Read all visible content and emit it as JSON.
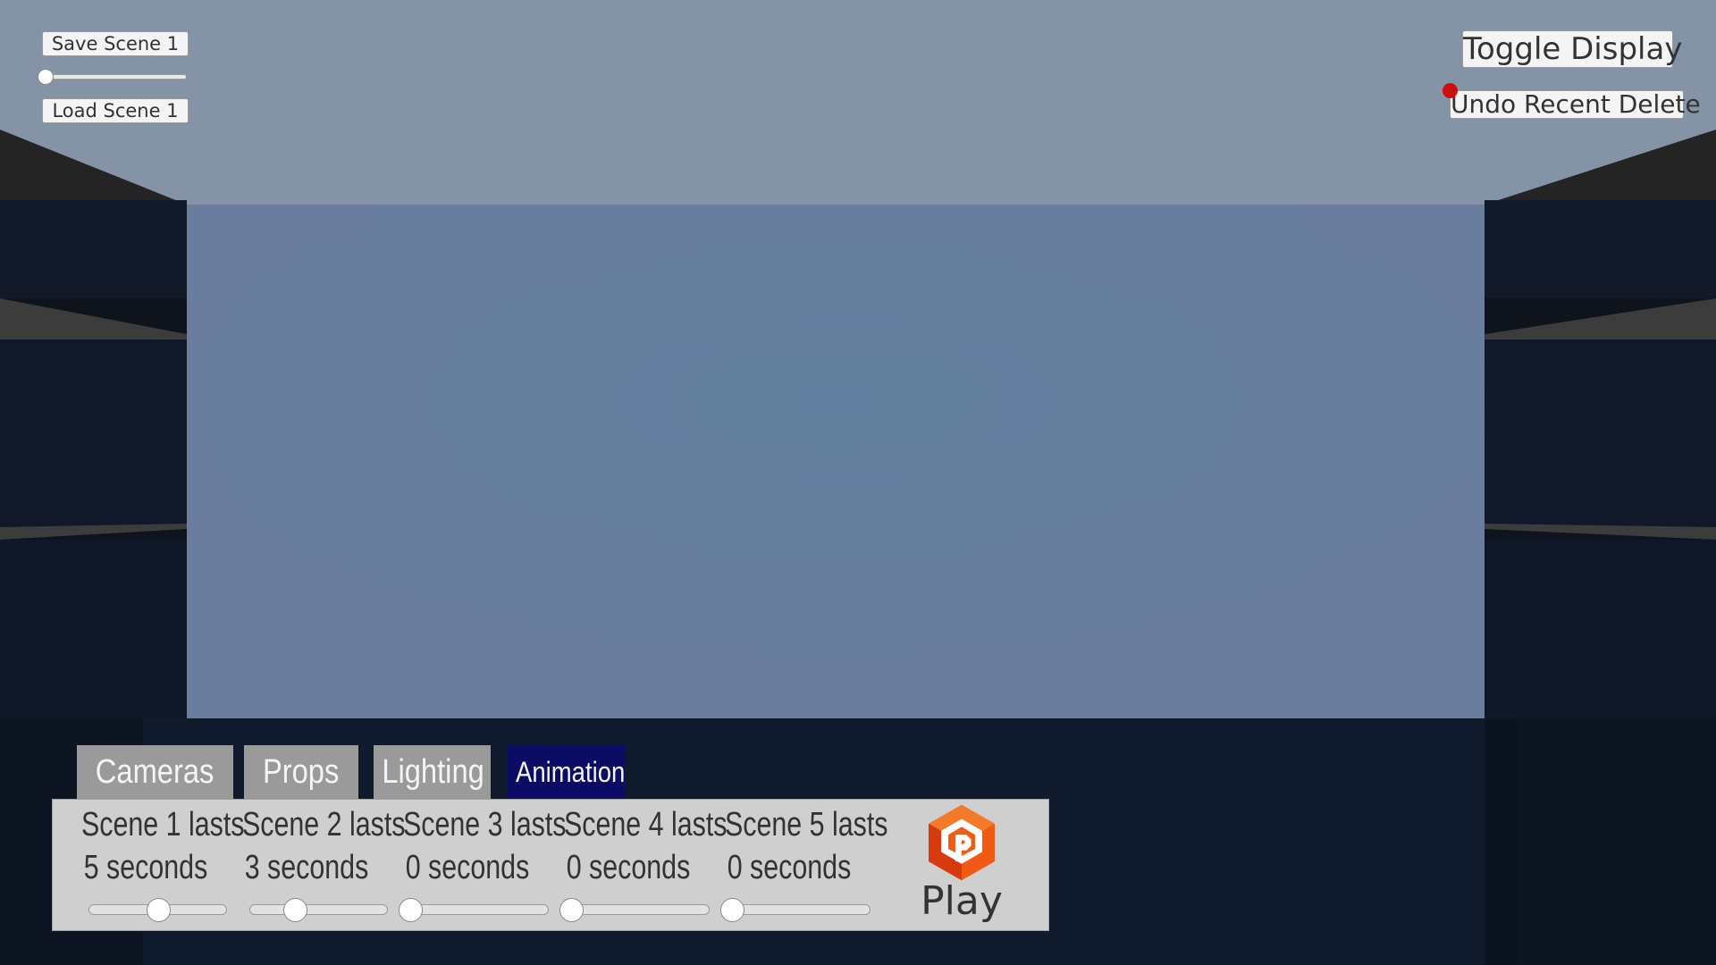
{
  "top_left": {
    "save_label": "Save Scene 1",
    "load_label": "Load Scene 1",
    "scene_slider_fraction": 0
  },
  "top_right": {
    "toggle_label": "Toggle Display",
    "undo_label": "Undo Recent Delete"
  },
  "tabs": [
    {
      "label": "Cameras",
      "active": false
    },
    {
      "label": "Props",
      "active": false
    },
    {
      "label": "Lighting",
      "active": false
    },
    {
      "label": "Animation",
      "active": true
    }
  ],
  "animation_panel": {
    "scenes": [
      {
        "title": "Scene 1 lasts",
        "duration": "5 seconds",
        "slider_fraction": 0.5
      },
      {
        "title": "Scene 2 lasts",
        "duration": "3 seconds",
        "slider_fraction": 0.33
      },
      {
        "title": "Scene 3 lasts",
        "duration": "0 seconds",
        "slider_fraction": 0
      },
      {
        "title": "Scene 4 lasts",
        "duration": "0 seconds",
        "slider_fraction": 0
      },
      {
        "title": "Scene 5 lasts",
        "duration": "0 seconds",
        "slider_fraction": 0
      }
    ],
    "play_label": "Play",
    "play_icon": "play-logo-icon"
  },
  "colors": {
    "active_tab": "#0c0c66",
    "inactive_tab": "#9a9a9a",
    "panel": "#cfcfcf",
    "backdrop": "#6a7f9f",
    "indicator_dot": "#cc0e0e",
    "play_logo_orange": "#f05a14"
  }
}
